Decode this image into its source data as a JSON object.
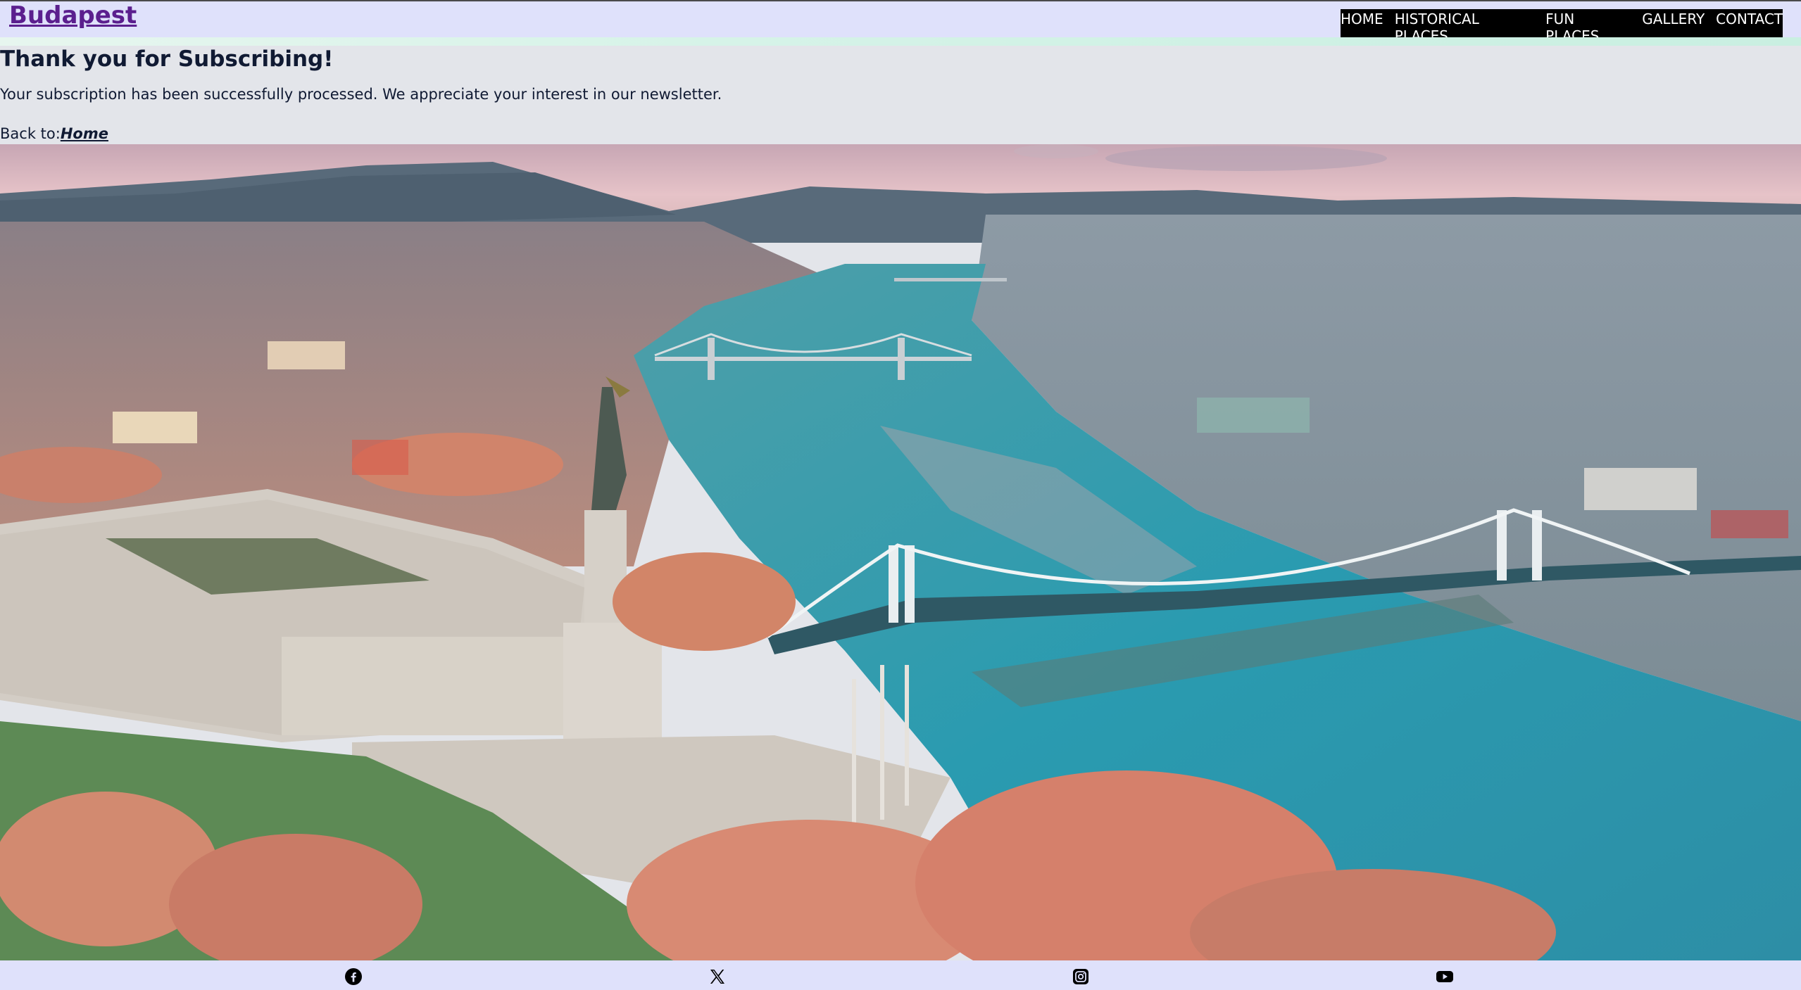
{
  "site": {
    "brand": "Budapest"
  },
  "nav": {
    "items": [
      {
        "label": "HOME"
      },
      {
        "label": "HISTORICAL PLACES"
      },
      {
        "label": "FUN PLACES"
      },
      {
        "label": "GALLERY"
      },
      {
        "label": "CONTACT"
      }
    ]
  },
  "main": {
    "heading": "Thank you for Subscribing!",
    "message": "Your subscription has been successfully processed. We appreciate your interest in our newsletter.",
    "back_prefix": "Back to:",
    "back_link": "Home"
  },
  "hero": {
    "icon": "budapest-aerial-photo"
  },
  "footer": {
    "social": [
      {
        "icon": "facebook-icon"
      },
      {
        "icon": "x-icon"
      },
      {
        "icon": "instagram-icon"
      },
      {
        "icon": "youtube-icon"
      }
    ]
  },
  "colors": {
    "header_bg": "#dfe1fb",
    "nav_bg": "#000000",
    "brand": "#5b1f8e",
    "text": "#101a33",
    "content_bg": "#e3e5ea"
  }
}
